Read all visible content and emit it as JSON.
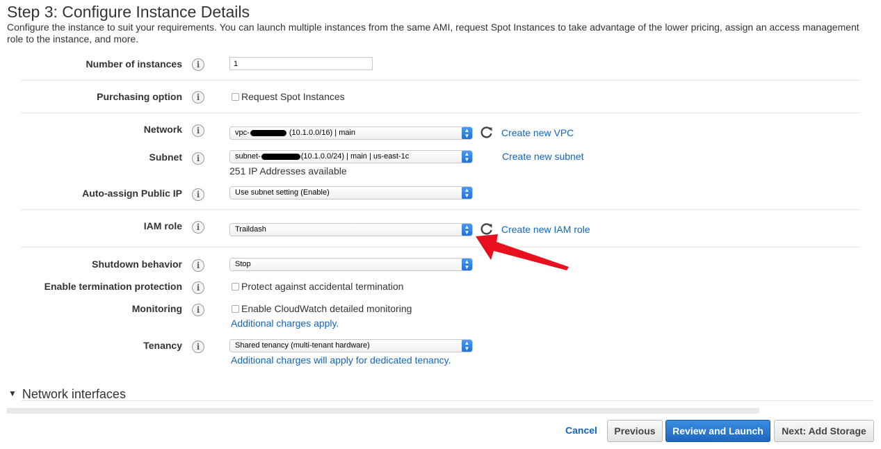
{
  "page": {
    "title": "Step 3: Configure Instance Details",
    "description": "Configure the instance to suit your requirements. You can launch multiple instances from the same AMI, request Spot Instances to take advantage of the lower pricing, assign an access management role to the instance, and more."
  },
  "fields": {
    "num_instances": {
      "label": "Number of instances",
      "value": "1"
    },
    "purchasing": {
      "label": "Purchasing option",
      "checkbox_label": "Request Spot Instances"
    },
    "network": {
      "label": "Network",
      "value_prefix": "vpc-",
      "value_suffix": "(10.1.0.0/16) | main",
      "link": "Create new VPC"
    },
    "subnet": {
      "label": "Subnet",
      "value_prefix": "subnet-",
      "value_suffix": "(10.1.0.0/24) | main | us-east-1c",
      "info": "251 IP Addresses available",
      "link": "Create new subnet"
    },
    "public_ip": {
      "label": "Auto-assign Public IP",
      "value": "Use subnet setting (Enable)"
    },
    "iam_role": {
      "label": "IAM role",
      "value": "Traildash",
      "link": "Create new IAM role"
    },
    "shutdown": {
      "label": "Shutdown behavior",
      "value": "Stop"
    },
    "termination": {
      "label": "Enable termination protection",
      "checkbox_label": "Protect against accidental termination"
    },
    "monitoring": {
      "label": "Monitoring",
      "checkbox_label": "Enable CloudWatch detailed monitoring",
      "link": "Additional charges apply."
    },
    "tenancy": {
      "label": "Tenancy",
      "value": "Shared tenancy (multi-tenant hardware)",
      "link": "Additional charges will apply for dedicated tenancy."
    }
  },
  "icons": {
    "info": "i",
    "select_arrows": "▲▼",
    "refresh": "refresh-icon",
    "caret": "▼"
  },
  "sections": {
    "network_interfaces": "Network interfaces"
  },
  "buttons": {
    "cancel": "Cancel",
    "previous": "Previous",
    "review_launch": "Review and Launch",
    "next": "Next: Add Storage"
  },
  "colors": {
    "link": "#1166bb",
    "primary_button": "#1e66c2",
    "annotation_arrow": "#e8101e"
  }
}
